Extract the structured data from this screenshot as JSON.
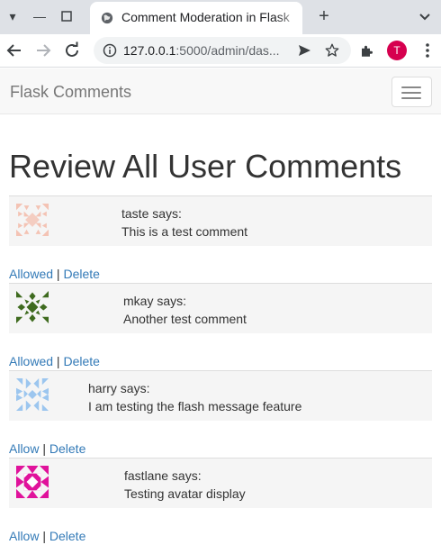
{
  "browser": {
    "tab_title": "Comment Moderation in Flask",
    "url_host": "127.0.0.1",
    "url_rest": ":5000/admin/das...",
    "profile_initial": "T"
  },
  "navbar": {
    "brand": "Flask Comments"
  },
  "page": {
    "title": "Review All User Comments"
  },
  "comments": [
    {
      "author": "taste says:",
      "text": "This is a test comment",
      "status_action": "Allowed",
      "delete_label": "Delete",
      "avatar_color": "#f4c3b4"
    },
    {
      "author": "mkay says:",
      "text": "Another test comment",
      "status_action": "Allowed",
      "delete_label": "Delete",
      "avatar_color": "#3f6b1f"
    },
    {
      "author": "harry says:",
      "text": "I am testing the flash message feature",
      "status_action": "Allow",
      "delete_label": "Delete",
      "avatar_color": "#9cc6ef"
    },
    {
      "author": "fastlane says:",
      "text": "Testing avatar display",
      "status_action": "Allow",
      "delete_label": "Delete",
      "avatar_color": "#e0129b"
    }
  ],
  "separator": "|",
  "colors": {
    "link": "#337ab7",
    "navbar_bg": "#f8f8f8",
    "comment_bg": "#f5f5f5"
  },
  "icons": [
    "globe-icon",
    "back-icon",
    "forward-icon",
    "reload-icon",
    "info-icon",
    "send-icon",
    "star-icon",
    "extensions-icon",
    "kebab-menu-icon",
    "hamburger-icon"
  ]
}
